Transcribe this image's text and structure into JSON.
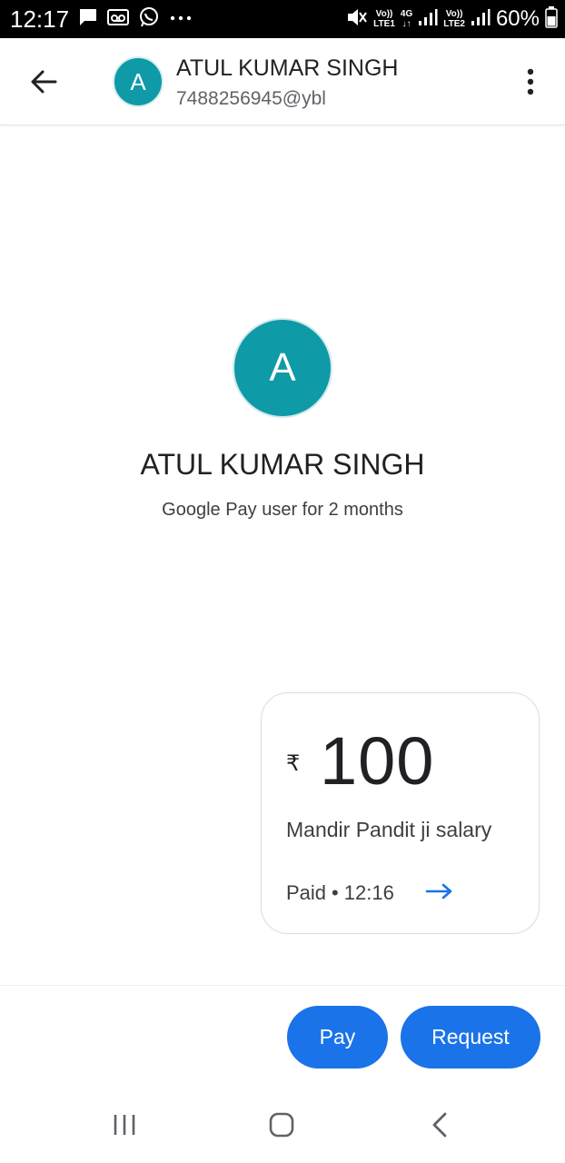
{
  "status_bar": {
    "time": "12:17",
    "sim1_label_top": "Vo))",
    "sim1_label_bottom": "LTE1",
    "network_4g": "4G",
    "sim2_label_top": "Vo))",
    "sim2_label_bottom": "LTE2",
    "battery": "60%",
    "icons": [
      "message-icon",
      "voicemail-icon",
      "whatsapp-icon",
      "more-dots-icon",
      "mute-icon",
      "signal-icon",
      "battery-icon"
    ]
  },
  "header": {
    "avatar_letter": "A",
    "name": "ATUL KUMAR SINGH",
    "upi_id": "7488256945@ybl"
  },
  "profile": {
    "avatar_letter": "A",
    "name": "ATUL KUMAR SINGH",
    "subtitle": "Google Pay user for 2 months"
  },
  "payment": {
    "currency": "₹",
    "amount": "100",
    "note": "Mandir Pandit ji salary",
    "status": "Paid",
    "separator": "•",
    "time": "12:16"
  },
  "actions": {
    "pay_label": "Pay",
    "request_label": "Request"
  },
  "colors": {
    "avatar": "#0f9aa8",
    "primary": "#1a73e8"
  }
}
